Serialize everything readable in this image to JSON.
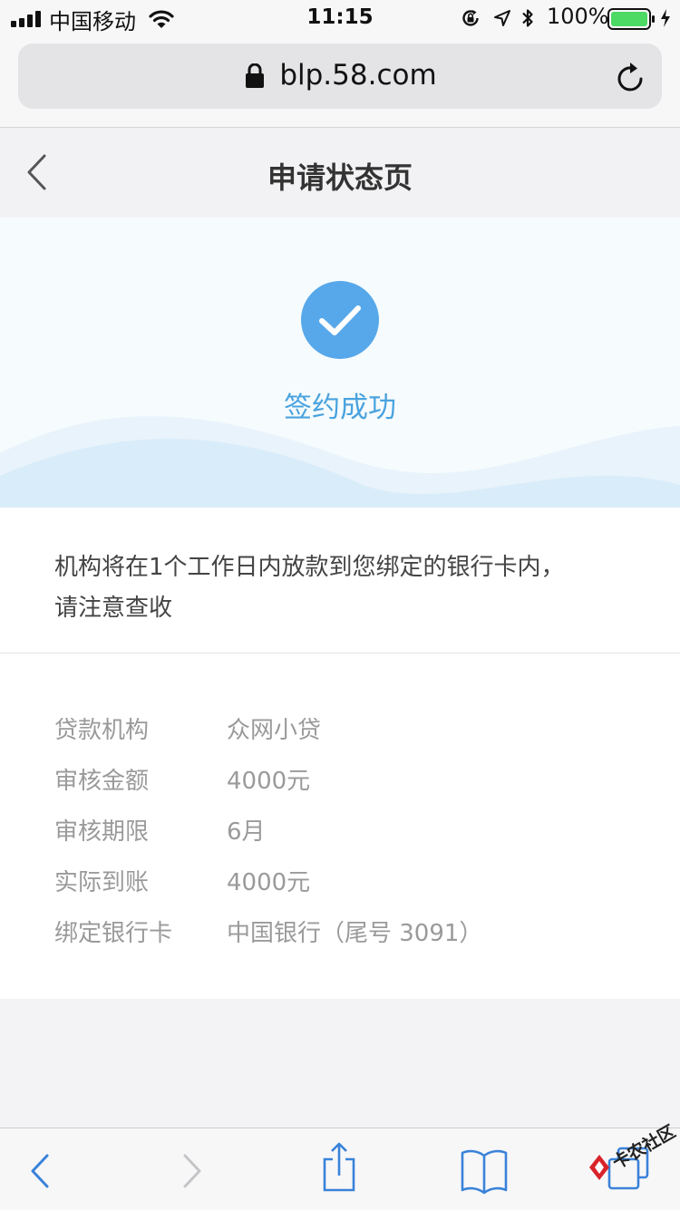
{
  "status_bar": {
    "carrier": "中国移动",
    "time": "11:15",
    "battery": "100%",
    "battery_level": 1.0
  },
  "browser": {
    "url": "blp.58.com"
  },
  "header": {
    "title": "申请状态页"
  },
  "hero": {
    "status_text": "签约成功"
  },
  "notice": {
    "line1": "机构将在1个工作日内放款到您绑定的银行卡内，",
    "line2": "请注意查收"
  },
  "details": [
    {
      "label": "贷款机构",
      "value": "众网小贷"
    },
    {
      "label": "审核金额",
      "value": "4000元"
    },
    {
      "label": "审核期限",
      "value": "6月"
    },
    {
      "label": "实际到账",
      "value": "4000元"
    },
    {
      "label": "绑定银行卡",
      "value": "中国银行（尾号 3091）"
    }
  ],
  "watermark": {
    "text": "卡农社区"
  },
  "colors": {
    "accent": "#4aa3df",
    "check_circle": "#57a8ea",
    "wave_light": "#e8f3fb",
    "wave_dark": "#d9ecf9",
    "toolbar_icon": "#3a82d9"
  }
}
